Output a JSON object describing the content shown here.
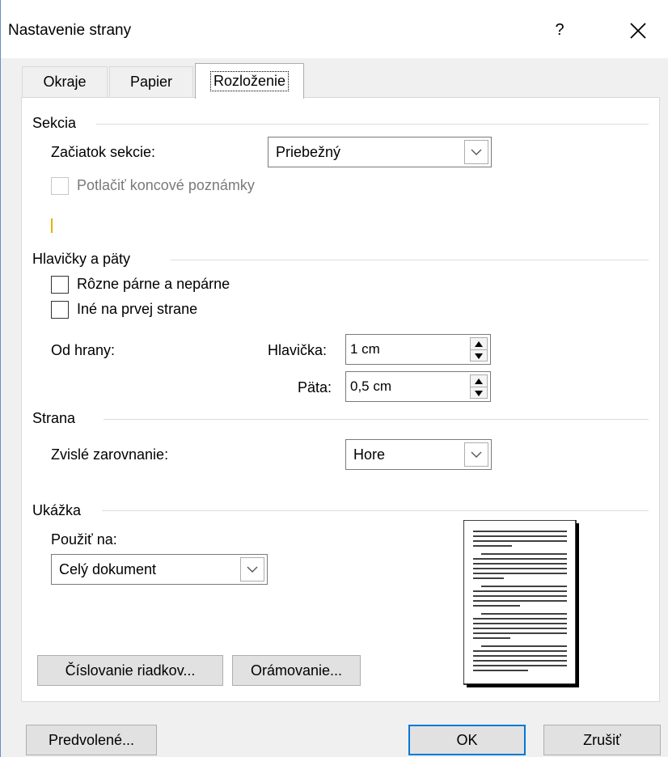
{
  "window": {
    "title": "Nastavenie strany",
    "help_label": "?",
    "close_icon": "close-icon"
  },
  "tabs": [
    {
      "label": "Okraje"
    },
    {
      "label": "Papier"
    },
    {
      "label": "Rozloženie"
    }
  ],
  "section": {
    "group_label": "Sekcia",
    "start_label": "Začiatok sekcie:",
    "start_value": "Priebežný",
    "suppress_endnotes_label": "Potlačiť koncové poznámky",
    "suppress_endnotes_checked": false
  },
  "headers_footers": {
    "group_label": "Hlavičky a päty",
    "odd_even_label": "Rôzne párne a nepárne",
    "odd_even_checked": false,
    "first_page_label": "Iné na prvej strane",
    "first_page_checked": false,
    "from_edge_label": "Od hrany:",
    "header_label": "Hlavička:",
    "header_value": "1 cm",
    "footer_label": "Päta:",
    "footer_value": "0,5 cm"
  },
  "page": {
    "group_label": "Strana",
    "vertical_alignment_label": "Zvislé zarovnanie:",
    "vertical_alignment_value": "Hore"
  },
  "preview": {
    "group_label": "Ukážka",
    "apply_to_label": "Použiť na:",
    "apply_to_value": "Celý dokument"
  },
  "buttons": {
    "line_numbers": "Číslovanie riadkov...",
    "borders": "Orámovanie...",
    "set_default": "Predvolené...",
    "ok": "OK",
    "cancel": "Zrušiť"
  },
  "colors": {
    "accent": "#0078d7",
    "dialog_bg": "#f0f0f0",
    "panel_bg": "#ffffff",
    "disabled_text": "#7a7a7a"
  }
}
